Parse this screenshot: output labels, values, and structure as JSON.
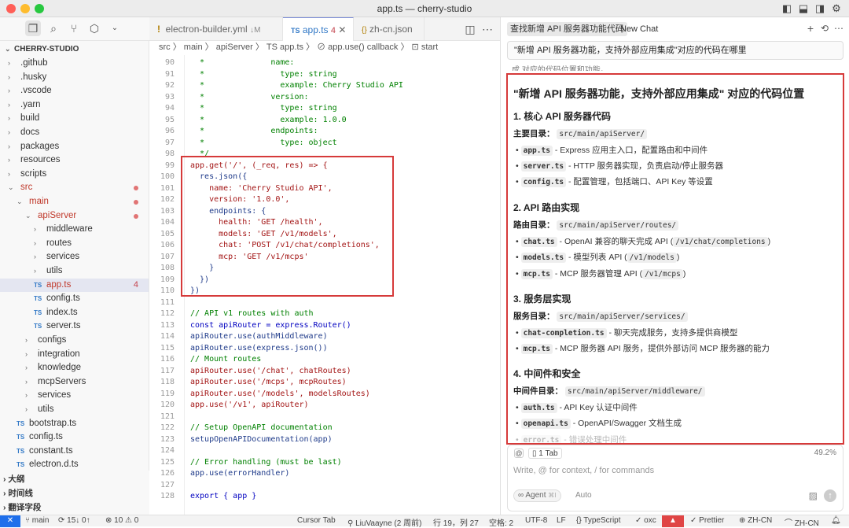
{
  "window": {
    "title": "app.ts — cherry-studio"
  },
  "activity_bar": {
    "icons": [
      "files-icon",
      "search-icon",
      "source-control-icon",
      "extensions-icon",
      "chevron-down-icon"
    ]
  },
  "explorer": {
    "root": "CHERRY-STUDIO",
    "items": [
      {
        "label": ".github"
      },
      {
        "label": ".husky"
      },
      {
        "label": ".vscode"
      },
      {
        "label": ".yarn"
      },
      {
        "label": "build"
      },
      {
        "label": "docs"
      },
      {
        "label": "packages"
      },
      {
        "label": "resources"
      },
      {
        "label": "scripts"
      },
      {
        "label": "src"
      },
      {
        "label": "main"
      },
      {
        "label": "apiServer"
      },
      {
        "label": "middleware"
      },
      {
        "label": "routes"
      },
      {
        "label": "services"
      },
      {
        "label": "utils"
      },
      {
        "label": "app.ts",
        "badge": "4"
      },
      {
        "label": "config.ts"
      },
      {
        "label": "index.ts"
      },
      {
        "label": "server.ts"
      },
      {
        "label": "configs"
      },
      {
        "label": "integration"
      },
      {
        "label": "knowledge"
      },
      {
        "label": "mcpServers"
      },
      {
        "label": "services"
      },
      {
        "label": "utils"
      },
      {
        "label": "bootstrap.ts"
      },
      {
        "label": "config.ts"
      },
      {
        "label": "constant.ts"
      },
      {
        "label": "electron.d.ts"
      }
    ],
    "ts_badge": "TS",
    "sections": [
      "大纲",
      "时间线",
      "翻译字段"
    ]
  },
  "editor_tabs": [
    {
      "label": "electron-builder.yml",
      "suffix": "↓M"
    },
    {
      "label": "app.ts",
      "suffix": "4"
    },
    {
      "label": "zh-cn.json",
      "suffix": ""
    }
  ],
  "breadcrumb": "src 〉 main 〉 apiServer 〉 TS app.ts 〉 ⊘ app.use() callback 〉 ⊡ start",
  "code": {
    "line_numbers": [
      "90",
      "91",
      "92",
      "93",
      "94",
      "95",
      "96",
      "97",
      "98",
      "99",
      "100",
      "101",
      "102",
      "103",
      "104",
      "105",
      "106",
      "107",
      "108",
      "109",
      "110",
      "111",
      "112",
      "113",
      "114",
      "115",
      "116",
      "117",
      "118",
      "119",
      "120",
      "121",
      "122",
      "123",
      "124",
      "125",
      "126",
      "127",
      "128"
    ],
    "lines": [
      "  *              name:",
      "  *                type: string",
      "  *                example: Cherry Studio API",
      "  *              version:",
      "  *                type: string",
      "  *                example: 1.0.0",
      "  *              endpoints:",
      "  *                type: object",
      "  */",
      "app.get('/', (_req, res) => {",
      "  res.json({",
      "    name: 'Cherry Studio API',",
      "    version: '1.0.0',",
      "    endpoints: {",
      "      health: 'GET /health',",
      "      models: 'GET /v1/models',",
      "      chat: 'POST /v1/chat/completions',",
      "      mcp: 'GET /v1/mcps'",
      "    }",
      "  })",
      "})",
      "",
      "// API v1 routes with auth",
      "const apiRouter = express.Router()",
      "apiRouter.use(authMiddleware)",
      "apiRouter.use(express.json())",
      "// Mount routes",
      "apiRouter.use('/chat', chatRoutes)",
      "apiRouter.use('/mcps', mcpRoutes)",
      "apiRouter.use('/models', modelsRoutes)",
      "app.use('/v1', apiRouter)",
      "",
      "// Setup OpenAPI documentation",
      "setupOpenAPIDocumentation(app)",
      "",
      "// Error handling (must be last)",
      "app.use(errorHandler)",
      "",
      "export { app }"
    ]
  },
  "chat": {
    "tabs": [
      "查找新增 API 服务器功能代码",
      "New Chat"
    ],
    "query": "\"新增 API 服务器功能，支持外部应用集成\"对应的代码在哪里",
    "cut_text": "成 对应的代码位置和功能。",
    "heading": "\"新增 API 服务器功能，支持外部应用集成\" 对应的代码位置",
    "sections": [
      {
        "title": "1. 核心 API 服务器代码",
        "dir_label": "主要目录：",
        "dir": "src/main/apiServer/",
        "items": [
          {
            "code": "app.ts",
            "desc": " - Express 应用主入口，配置路由和中间件"
          },
          {
            "code": "server.ts",
            "desc": " - HTTP 服务器实现，负责启动/停止服务器"
          },
          {
            "code": "config.ts",
            "desc": " - 配置管理，包括端口、API Key 等设置"
          }
        ]
      },
      {
        "title": "2. API 路由实现",
        "dir_label": "路由目录：",
        "dir": "src/main/apiServer/routes/",
        "items": [
          {
            "code": "chat.ts",
            "desc": " - OpenAI 兼容的聊天完成 API (",
            "code2": "/v1/chat/completions",
            "end": ")"
          },
          {
            "code": "models.ts",
            "desc": " - 模型列表 API (",
            "code2": "/v1/models",
            "end": ")"
          },
          {
            "code": "mcp.ts",
            "desc": " - MCP 服务器管理 API (",
            "code2": "/v1/mcps",
            "end": ")"
          }
        ]
      },
      {
        "title": "3. 服务层实现",
        "dir_label": "服务目录：",
        "dir": "src/main/apiServer/services/",
        "items": [
          {
            "code": "chat-completion.ts",
            "desc": " - 聊天完成服务，支持多提供商模型"
          },
          {
            "code": "mcp.ts",
            "desc": " - MCP 服务器 API 服务，提供外部访问 MCP 服务器的能力"
          }
        ]
      },
      {
        "title": "4. 中间件和安全",
        "dir_label": "中间件目录：",
        "dir": "src/main/apiServer/middleware/",
        "items": [
          {
            "code": "auth.ts",
            "desc": " - API Key 认证中间件"
          },
          {
            "code": "openapi.ts",
            "desc": " - OpenAPI/Swagger 文档生成"
          },
          {
            "code": "error.ts",
            "desc": " - 错误处理中间件"
          }
        ]
      }
    ],
    "composer": {
      "tab_chip": "1 Tab",
      "usage": "49.2%",
      "placeholder": "Write, @ for context, / for commands",
      "agent": "Agent",
      "agent_shortcut": "⌘I",
      "mode": "Auto"
    }
  },
  "status_bar": {
    "branch": "main",
    "sync": "⟳ 15↓ 0↑",
    "problems": "⊗ 10 ⚠ 0",
    "cursor_tab": "Cursor Tab",
    "blame": "LiuVaayne (2 周前)",
    "position": "行 19，列 27",
    "spaces": "空格: 2",
    "encoding": "UTF-8",
    "eol": "LF",
    "language": "{} TypeScript",
    "oxc": "✓ oxc",
    "prettier": "✓ Prettier",
    "lang1": "ZH-CN",
    "lang2": "ZH-CN"
  },
  "colors": {
    "accent": "#3178c6",
    "highlight_box": "#d63a3a",
    "status_remote": "#1f6feb",
    "brand": "#e04545"
  }
}
